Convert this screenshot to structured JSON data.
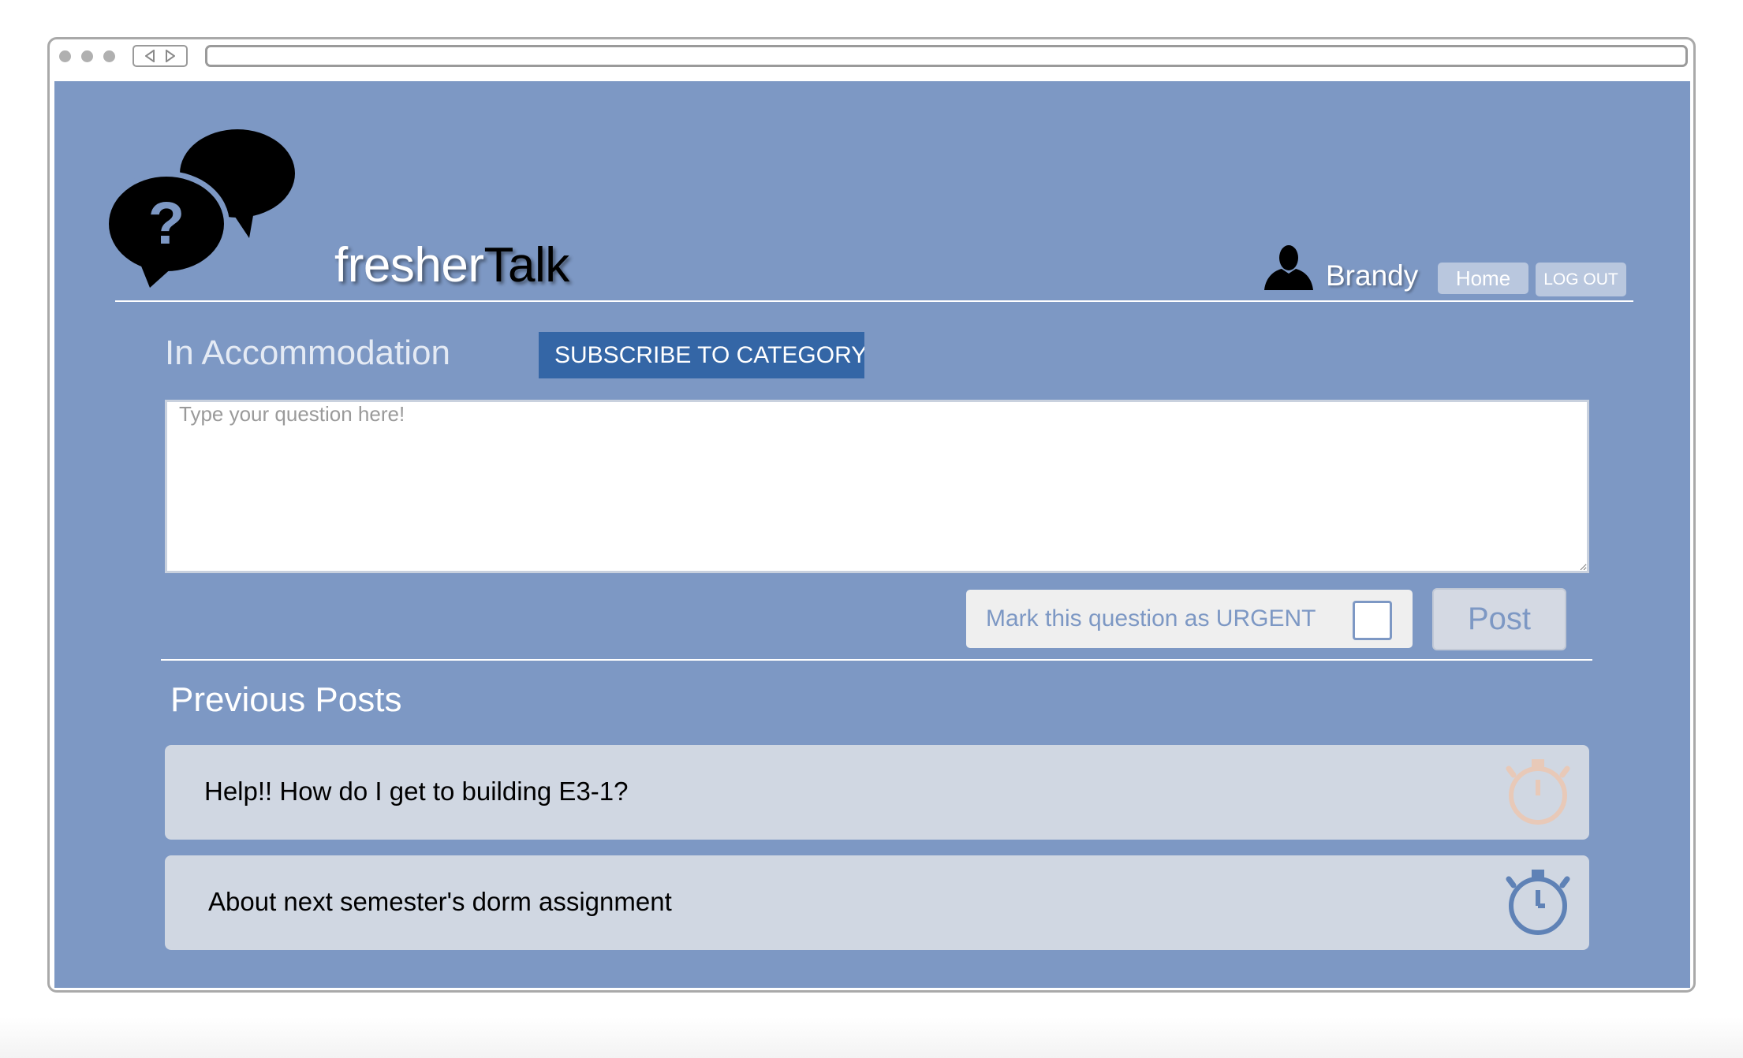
{
  "brand": {
    "part1": "fresher",
    "part2": "Talk"
  },
  "header": {
    "username": "Brandy",
    "home_label": "Home",
    "logout_label": "LOG OUT"
  },
  "category": {
    "title": "In Accommodation",
    "subscribe_label": "SUBSCRIBE TO CATEGORY"
  },
  "composer": {
    "placeholder": "Type your question here!",
    "value": "",
    "urgent_label": "Mark this question as URGENT",
    "urgent_checked": false,
    "post_label": "Post"
  },
  "previous_posts": {
    "title": "Previous Posts",
    "items": [
      {
        "title": "Help!! How do I get to building E3-1?",
        "timer_icon": "stopwatch-icon",
        "timer_color": "#e8c9b8"
      },
      {
        "title": "About next semester's dorm assignment",
        "timer_icon": "stopwatch-icon",
        "timer_color": "#5f82b6"
      }
    ]
  },
  "colors": {
    "page_background": "#7d98c4",
    "subscribe_button": "#3466a6",
    "post_row_background": "#d0d7e2"
  }
}
